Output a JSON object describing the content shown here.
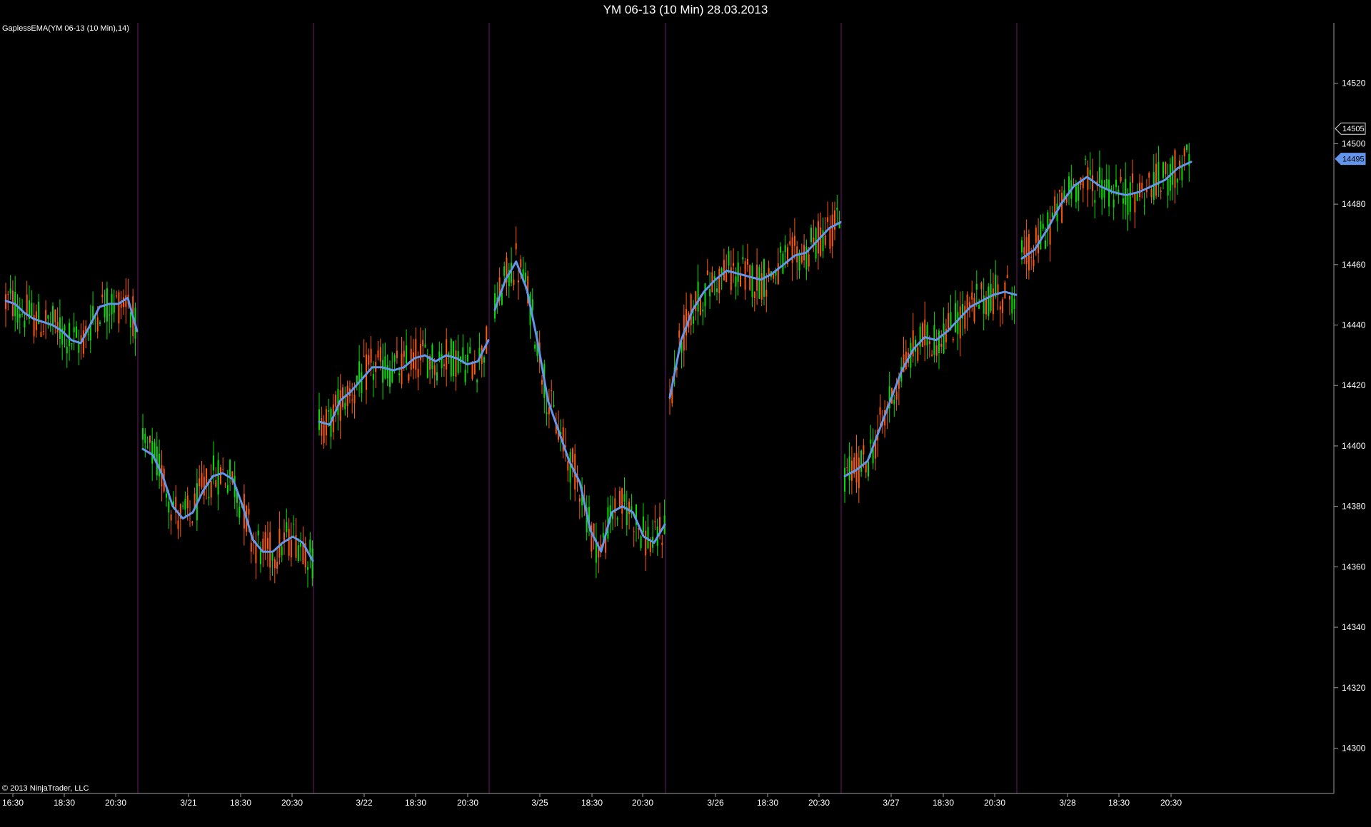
{
  "window": {
    "title": "YM 06-13 (10 Min)  28.03.2013"
  },
  "indicator": {
    "label": "GaplessEMA(YM 06-13 (10 Min),14)"
  },
  "footer": {
    "copyright": "© 2013 NinjaTrader, LLC"
  },
  "colors": {
    "background": "#000000",
    "up_candle": "#00e000",
    "down_candle": "#ff5a0a",
    "ema_line": "#6495ed",
    "session_line": "#6a1a6a",
    "axis": "#9a9a9a"
  },
  "chart_data": {
    "type": "candlestick",
    "title": "YM 06-13 (10 Min)  28.03.2013",
    "ylim": [
      14285,
      14540
    ],
    "y_ticks": [
      14300,
      14320,
      14340,
      14360,
      14380,
      14400,
      14420,
      14440,
      14460,
      14480,
      14500,
      14520
    ],
    "x_tick_labels": [
      "16:30",
      "18:30",
      "20:30",
      "3/21",
      "18:30",
      "20:30",
      "3/22",
      "18:30",
      "20:30",
      "3/25",
      "18:30",
      "20:30",
      "3/26",
      "18:30",
      "20:30",
      "3/27",
      "18:30",
      "20:30",
      "3/28",
      "18:30",
      "20:30"
    ],
    "session_breaks": [
      "3/21",
      "3/22",
      "3/25",
      "3/26",
      "3/27",
      "3/28"
    ],
    "price_tags": [
      {
        "name": "last-price",
        "value": 14505,
        "label": "14505"
      },
      {
        "name": "ema-value",
        "value": 14495,
        "label": "14495"
      }
    ],
    "ema": {
      "name": "GaplessEMA(YM 06-13 (10 Min),14)",
      "sessions": [
        [
          14448,
          14447,
          14444,
          14442,
          14441,
          14440,
          14438,
          14435,
          14434,
          14440,
          14446,
          14447,
          14447,
          14449,
          14438
        ],
        [
          14399,
          14397,
          14390,
          14380,
          14376,
          14378,
          14385,
          14390,
          14391,
          14389,
          14380,
          14369,
          14365,
          14365,
          14368,
          14370,
          14368,
          14362
        ],
        [
          14408,
          14407,
          14415,
          14418,
          14422,
          14426,
          14426,
          14425,
          14426,
          14429,
          14430,
          14428,
          14430,
          14429,
          14427,
          14428,
          14435
        ],
        [
          14445,
          14455,
          14461,
          14452,
          14435,
          14415,
          14405,
          14395,
          14388,
          14372,
          14365,
          14378,
          14380,
          14378,
          14370,
          14368,
          14374
        ],
        [
          14416,
          14435,
          14445,
          14451,
          14455,
          14458,
          14457,
          14456,
          14455,
          14457,
          14460,
          14463,
          14464,
          14468,
          14472,
          14474
        ],
        [
          14390,
          14392,
          14395,
          14405,
          14415,
          14425,
          14432,
          14436,
          14435,
          14438,
          14442,
          14446,
          14448,
          14450,
          14451,
          14450
        ],
        [
          14462,
          14465,
          14472,
          14480,
          14486,
          14489,
          14486,
          14484,
          14483,
          14484,
          14486,
          14488,
          14492,
          14494
        ]
      ]
    }
  }
}
